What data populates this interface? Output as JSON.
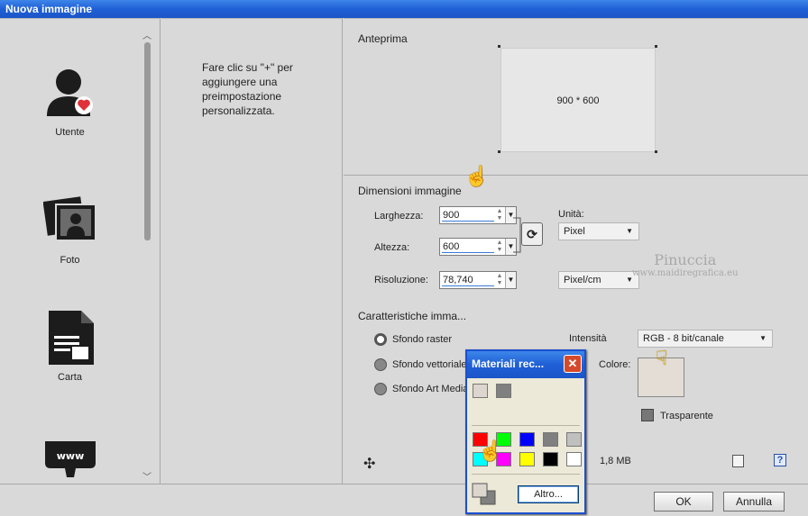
{
  "window": {
    "title": "Nuova immagine"
  },
  "presets": [
    {
      "label": "Utente",
      "icon": "user-icon"
    },
    {
      "label": "Foto",
      "icon": "photo-icon"
    },
    {
      "label": "Carta",
      "icon": "paper-icon"
    },
    {
      "label": "",
      "icon": "web-icon"
    }
  ],
  "hint": "Fare clic su \"+\" per aggiungere una preimpostazione personalizzata.",
  "preview": {
    "title": "Anteprima",
    "size_text": "900 * 600"
  },
  "dimensions": {
    "title": "Dimensioni immagine",
    "width_label": "Larghezza:",
    "width_value": "900",
    "height_label": "Altezza:",
    "height_value": "600",
    "resolution_label": "Risoluzione:",
    "resolution_value": "78,740",
    "units_label": "Unità:",
    "units_value": "Pixel",
    "resolution_unit": "Pixel/cm"
  },
  "characteristics": {
    "title": "Caratteristiche imma...",
    "raster": "Sfondo raster",
    "vector": "Sfondo vettoriale",
    "artmedia": "Sfondo Art Media",
    "intensity_label": "Intensità",
    "intensity_value": "RGB - 8 bit/canale",
    "color_label": "Colore:",
    "transparent": "Trasparente",
    "memory": "1,8 MB"
  },
  "watermark": {
    "name": "Pinuccia",
    "site": "www.maidiregrafica.eu"
  },
  "buttons": {
    "ok": "OK",
    "cancel": "Annulla"
  },
  "popup": {
    "title": "Materiali rec...",
    "recent": [
      "#dcd6cf",
      "#808080"
    ],
    "palette": [
      "#ff0000",
      "#00ff00",
      "#0000ff",
      "#808080",
      "#c0c0c0",
      "#00ffff",
      "#ff00ff",
      "#ffff00",
      "#000000",
      "#ffffff"
    ],
    "more_button": "Altro..."
  }
}
